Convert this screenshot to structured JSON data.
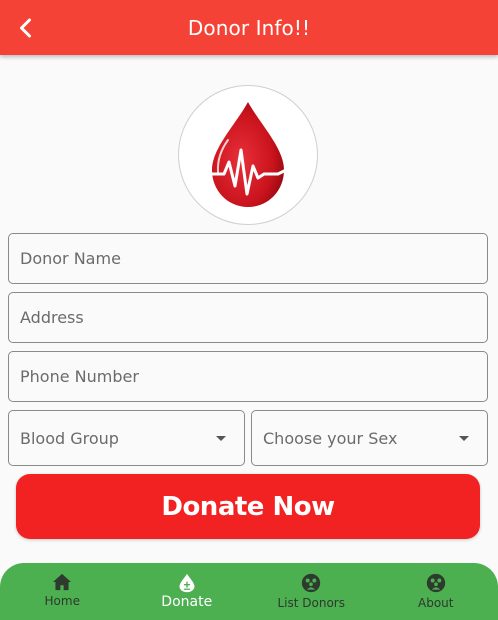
{
  "app_bar": {
    "title": "Donor Info!!",
    "back_icon": "chevron-left-icon"
  },
  "logo": {
    "icon": "blood-drop-heartbeat-icon",
    "drop_color": "#d31a24"
  },
  "form": {
    "donor_name_placeholder": "Donor Name",
    "address_placeholder": "Address",
    "phone_placeholder": "Phone Number",
    "blood_group_label": "Blood Group",
    "sex_label": "Choose your Sex"
  },
  "donate_button": {
    "label": "Donate Now",
    "color": "#f22222"
  },
  "bottom_nav": {
    "color": "#4caf50",
    "items": [
      {
        "label": "Home",
        "icon": "home-icon",
        "active": false
      },
      {
        "label": "Donate",
        "icon": "blood-drop-icon",
        "active": true
      },
      {
        "label": "List Donors",
        "icon": "group-icon",
        "active": false
      },
      {
        "label": "About",
        "icon": "group-icon",
        "active": false
      }
    ]
  }
}
